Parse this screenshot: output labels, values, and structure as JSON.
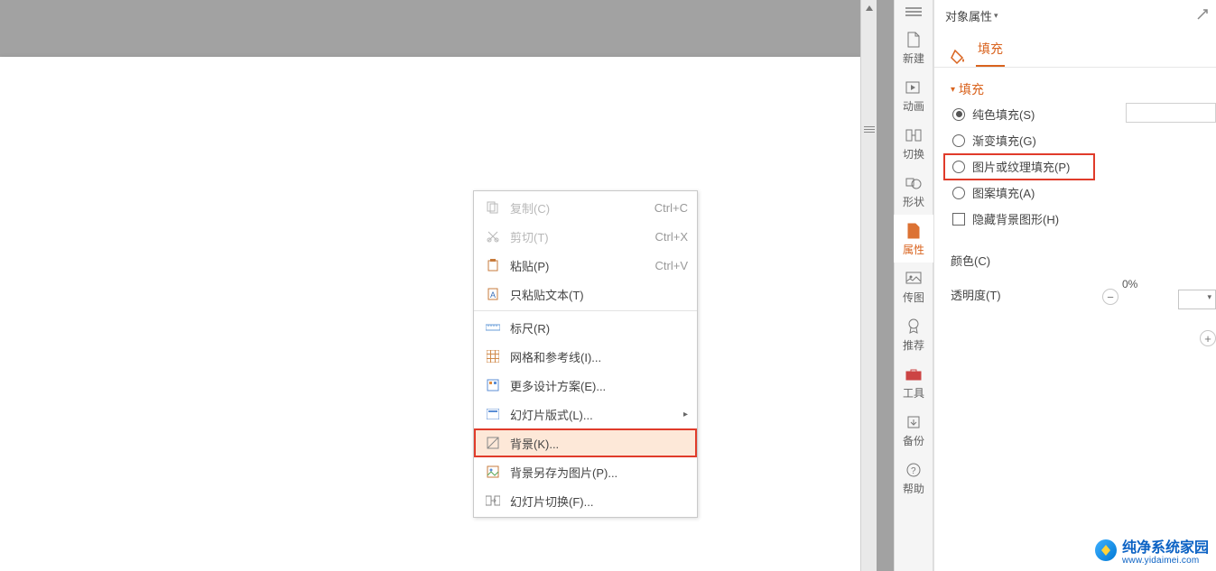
{
  "context_menu": {
    "copy": {
      "label": "复制(C)",
      "shortcut": "Ctrl+C"
    },
    "cut": {
      "label": "剪切(T)",
      "shortcut": "Ctrl+X"
    },
    "paste": {
      "label": "粘贴(P)",
      "shortcut": "Ctrl+V"
    },
    "paste_text": {
      "label": "只粘贴文本(T)"
    },
    "ruler": {
      "label": "标尺(R)"
    },
    "grid": {
      "label": "网格和参考线(I)..."
    },
    "more_design": {
      "label": "更多设计方案(E)..."
    },
    "slide_layout": {
      "label": "幻灯片版式(L)..."
    },
    "background": {
      "label": "背景(K)..."
    },
    "save_bg": {
      "label": "背景另存为图片(P)..."
    },
    "slide_trans": {
      "label": "幻灯片切换(F)..."
    }
  },
  "toolbar": {
    "new": "新建",
    "anim": "动画",
    "trans": "切换",
    "shape": "形状",
    "props": "属性",
    "img": "传图",
    "recommend": "推荐",
    "tools": "工具",
    "backup": "备份",
    "help": "帮助"
  },
  "panel": {
    "title": "对象属性",
    "tab_fill": "填充",
    "section_fill": "填充",
    "fill_solid": "纯色填充(S)",
    "fill_gradient": "渐变填充(G)",
    "fill_picture": "图片或纹理填充(P)",
    "fill_pattern": "图案填充(A)",
    "hide_bg": "隐藏背景图形(H)",
    "color_label": "颜色(C)",
    "transparency_label": "透明度(T)",
    "transparency_value": "0%"
  },
  "watermark": {
    "title": "纯净系统家园",
    "url": "www.yidaimei.com"
  }
}
